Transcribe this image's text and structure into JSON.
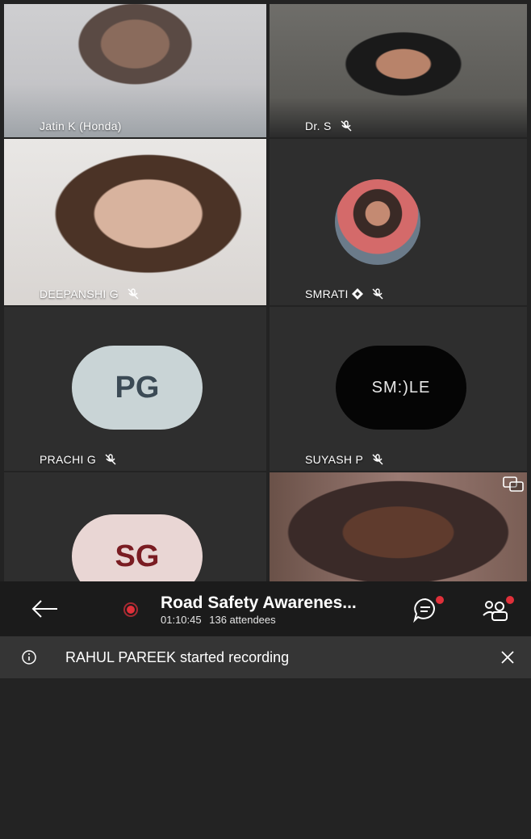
{
  "participants": [
    {
      "name": "Jatin K (Honda)",
      "muted": false
    },
    {
      "name": "Dr. S",
      "muted": true
    },
    {
      "name": "DEEPANSHI G",
      "muted": true
    },
    {
      "name": "SMRATI",
      "muted": true,
      "badge": true
    },
    {
      "name": "PRACHI G",
      "muted": true,
      "initials": "PG",
      "avatar_color": "#c9d4d6",
      "text_color": "#3b4a55"
    },
    {
      "name": "SUYASH P",
      "muted": true,
      "avatar_text": "SM:)LE"
    },
    {
      "initials": "SG",
      "avatar_color": "#e9d6d4",
      "text_color": "#7a1c22"
    },
    {
      "name": ""
    }
  ],
  "meeting": {
    "title": "Road Safety Awarenes...",
    "duration": "01:10:45",
    "attendees": "136 attendees",
    "record_color": "#e0303a"
  },
  "notice": {
    "text": "RAHUL PAREEK started recording"
  },
  "colors": {
    "badge_red": "#e0303a"
  }
}
